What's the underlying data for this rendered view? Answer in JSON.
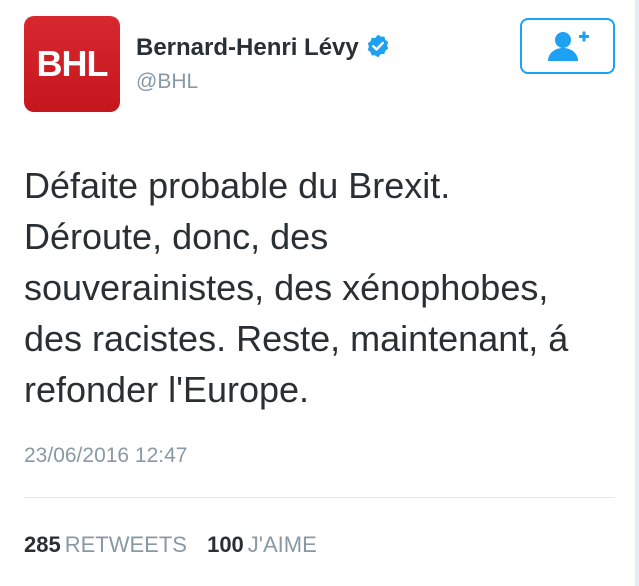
{
  "author": {
    "avatar_text": "BHL",
    "display_name": "Bernard-Henri Lévy",
    "handle": "@BHL",
    "verified_icon": "verified-badge-icon",
    "follow_icon": "add-user-icon"
  },
  "tweet": {
    "lines": [
      "Défaite probable du Brexit.",
      "Déroute, donc, des",
      "souverainistes, des xénophobes,",
      "des racistes. Reste, maintenant, á",
      "refonder l'Europe."
    ],
    "timestamp": "23/06/2016 12:47"
  },
  "stats": {
    "retweets_count": "285",
    "retweets_label": "RETWEETS",
    "likes_count": "100",
    "likes_label": "J'AIME"
  },
  "colors": {
    "accent": "#1da1f2",
    "avatar_bg": "#c4161c",
    "text_primary": "#292f33",
    "text_secondary": "#8899a6"
  }
}
